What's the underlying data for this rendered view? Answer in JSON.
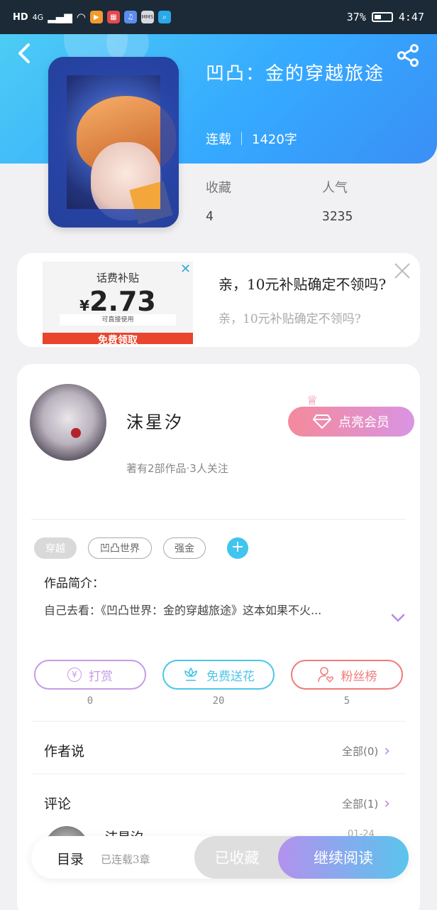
{
  "status_bar": {
    "left_labels": [
      "HD",
      "4G"
    ],
    "battery_percent": "37%",
    "time": "4:47"
  },
  "book": {
    "title": "凹凸：金的穿越旅途",
    "status": "连载",
    "word_count": "1420字",
    "stats": [
      {
        "label": "收藏",
        "value": "4"
      },
      {
        "label": "人气",
        "value": "3235"
      }
    ]
  },
  "ad": {
    "image_title": "话费补贴",
    "image_currency": "¥",
    "image_amount": "2.73",
    "image_note": "可直接使用",
    "image_button": "免费领取",
    "title": "亲，10元补贴确定不领吗?",
    "subtitle": "亲，10元补贴确定不领吗?"
  },
  "author": {
    "name": "沫星汐",
    "info": "著有2部作品·3人关注",
    "vip_label": "点亮会员"
  },
  "tags": [
    "穿越",
    "凹凸世界",
    "强金"
  ],
  "intro": {
    "label": "作品简介：",
    "text": "自己去看：《凹凸世界：金的穿越旅途》这本如果不火..."
  },
  "actions": [
    {
      "label": "打赏",
      "count": "0",
      "color": "#c79be6"
    },
    {
      "label": "免费送花",
      "count": "20",
      "color": "#4cc6e8"
    },
    {
      "label": "粉丝榜",
      "count": "5",
      "color": "#f07b7b"
    }
  ],
  "sections": {
    "author_says": {
      "title": "作者说",
      "link": "全部(0)"
    },
    "comments": {
      "title": "评论",
      "link": "全部(1)"
    }
  },
  "comment": {
    "name": "沫星汐",
    "time": "01-24"
  },
  "bottom_bar": {
    "toc_label": "目录",
    "toc_sub": "已连载3章",
    "collected_label": "已收藏",
    "read_label": "继续阅读"
  }
}
